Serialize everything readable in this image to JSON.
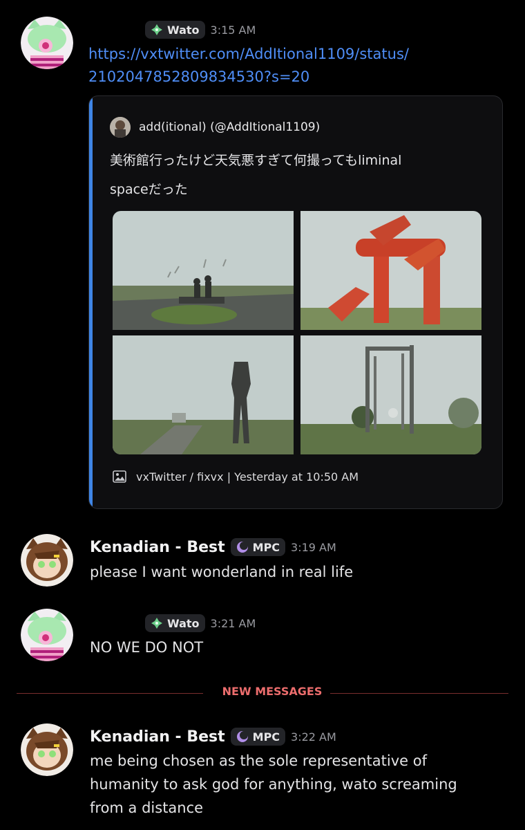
{
  "messages": [
    {
      "author": "Wato",
      "time": "3:15 AM",
      "link_line1": "https://vxtwitter.com/AddItional1109/status/",
      "link_line2": "2102047852809834530?s=20",
      "embed": {
        "author": "add(itional) (@AddItional1109)",
        "desc_line1": "美術館行ったけど天気悪すぎて何撮ってもliminal",
        "desc_line2": "spaceだった",
        "footer": "vxTwitter / fixvx | Yesterday at 10:50 AM",
        "accent": "#3f85e6"
      }
    },
    {
      "author": "Kenadian - Best",
      "tag": "MPC",
      "time": "3:19 AM",
      "text": "please I want wonderland in real life"
    },
    {
      "author": "Wato",
      "time": "3:21 AM",
      "text": "NO WE DO NOT"
    },
    {
      "author": "Kenadian - Best",
      "tag": "MPC",
      "time": "3:22 AM",
      "text_line1": "me being chosen as the sole representative of",
      "text_line2": "humanity to ask god for anything, wato screaming",
      "text_line3": "from a distance"
    }
  ],
  "divider_label": "NEW MESSAGES",
  "colors": {
    "link": "#4f8ef7",
    "new_messages": "#ec6d6d",
    "background": "#000000"
  }
}
